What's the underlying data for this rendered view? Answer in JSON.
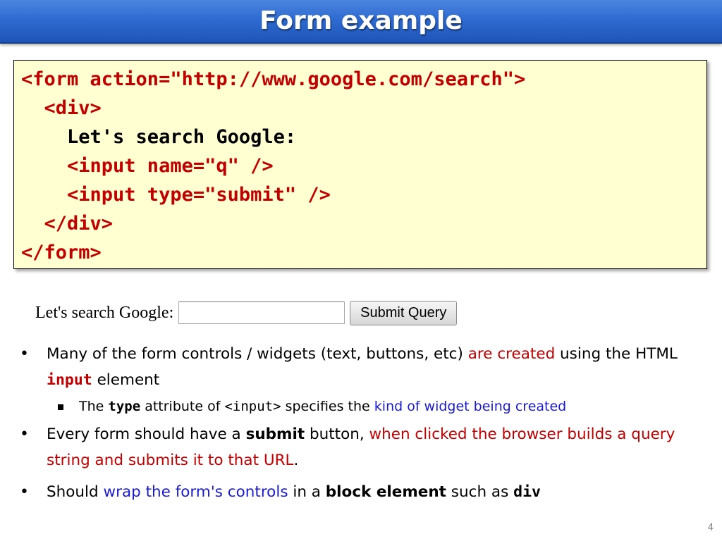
{
  "slide": {
    "title": "Form example",
    "page_number": "4"
  },
  "code": {
    "lines": [
      "<form action=\"http://www.google.com/search\">",
      "  <div>",
      "    Let's search Google:",
      "    <input name=\"q\" />",
      "    <input type=\"submit\" />",
      "  </div>",
      "</form>"
    ]
  },
  "demo": {
    "label": "Let's search Google:",
    "input_value": "",
    "submit_label": "Submit Query"
  },
  "bullets": {
    "b1": {
      "t1": "Many of the form controls / widgets (text, buttons, etc)  ",
      "t2": "are created",
      "t3": " using the HTML ",
      "t4": "input",
      "t5": " element"
    },
    "b1_sub": {
      "t1": "The ",
      "t2": "type",
      "t3": " attribute of ",
      "t4": "<input>",
      "t5": " specifies the ",
      "t6": "kind of widget being created"
    },
    "b2": {
      "t1": "Every form should have a ",
      "t2": "submit",
      "t3": " button, ",
      "t4": "when clicked the browser builds a query string and submits it to that URL",
      "t5": "."
    },
    "b3": {
      "t1": "Should ",
      "t2": "wrap the form's controls",
      "t3": " in a ",
      "t4": "block element",
      "t5": " such as ",
      "t6": "div"
    }
  },
  "colors": {
    "title_bar": "#2f6bd1",
    "code_background": "#ffffd2",
    "tag_red": "#c00000",
    "link_blue": "#1a1ad1"
  }
}
